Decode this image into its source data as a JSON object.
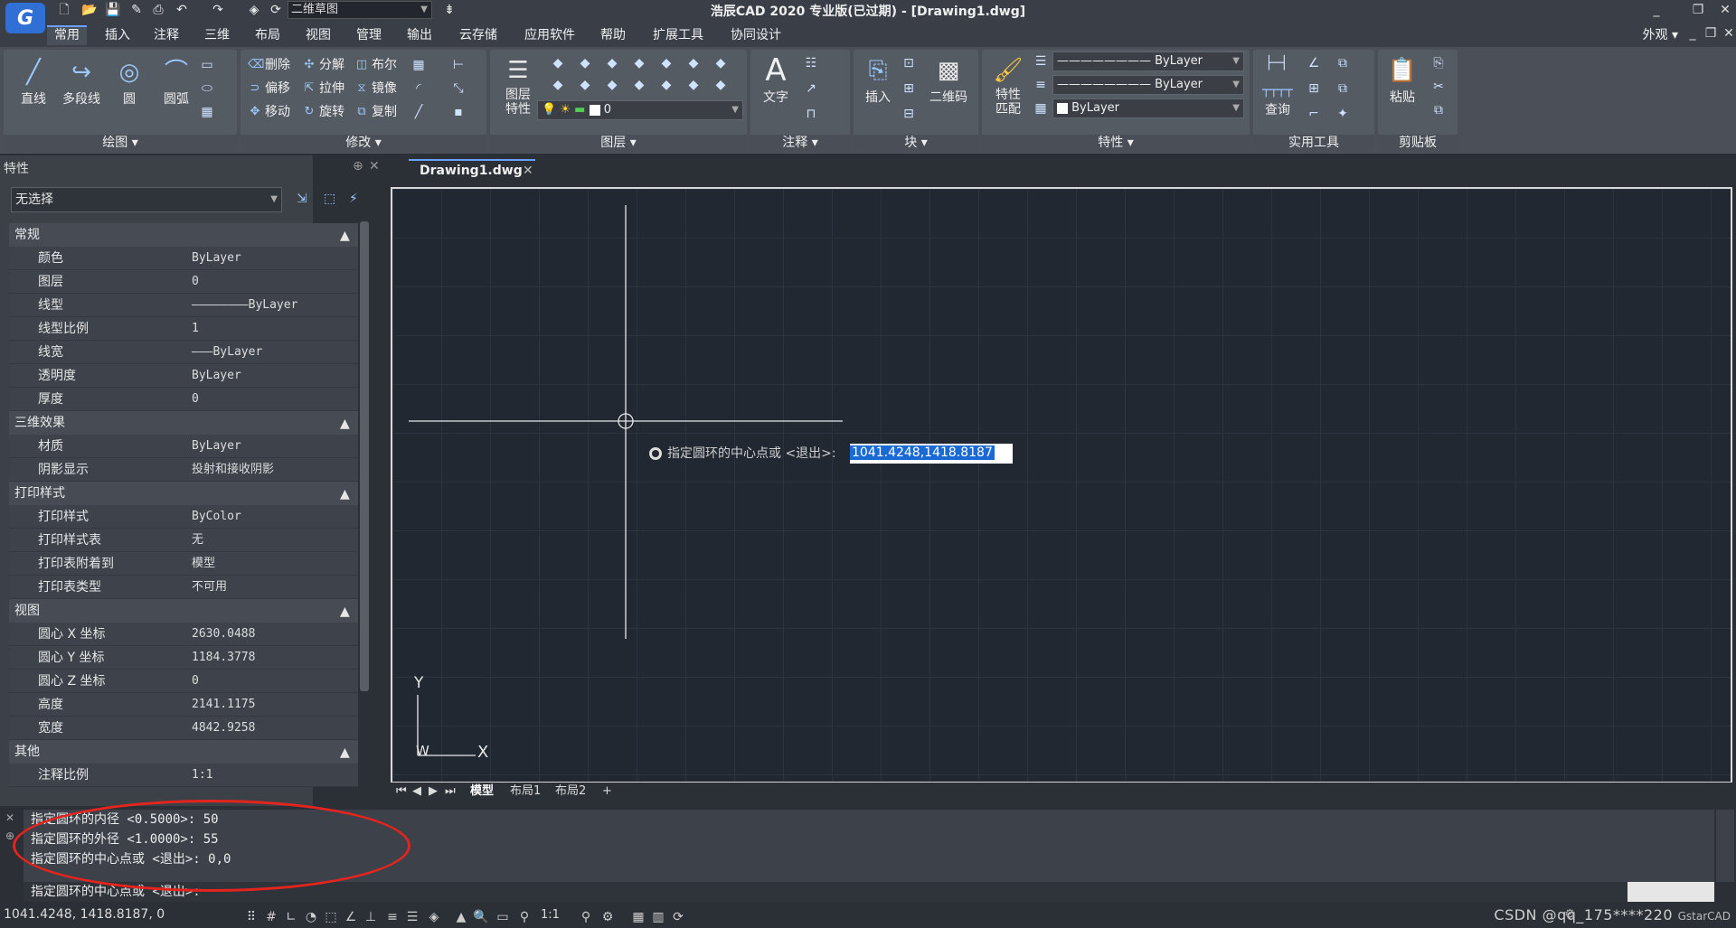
{
  "titlebar": {
    "title": "浩辰CAD 2020 专业版(已过期) - [Drawing1.dwg]",
    "workspace": "二维草图",
    "logo_text": "G"
  },
  "menu": {
    "tabs": [
      "常用",
      "插入",
      "注释",
      "三维",
      "布局",
      "视图",
      "管理",
      "输出",
      "云存储",
      "应用软件",
      "帮助",
      "扩展工具",
      "协同设计"
    ],
    "active_index": 0,
    "appearance": "外观"
  },
  "ribbon": {
    "draw": {
      "title": "绘图",
      "line": "直线",
      "polyline": "多段线",
      "circle": "圆",
      "arc": "圆弧"
    },
    "modify": {
      "title": "修改",
      "erase": "删除",
      "explode": "分解",
      "boolean": "布尔",
      "offset": "偏移",
      "stretch": "拉伸",
      "mirror": "镜像",
      "move": "移动",
      "rotate": "旋转",
      "copy": "复制"
    },
    "layers": {
      "title": "图层",
      "layer_props": "图层\n特性",
      "current_layer": "0"
    },
    "annotation": {
      "title": "注释",
      "text": "文字"
    },
    "block": {
      "title": "块",
      "insert": "插入",
      "qrcode": "二维码"
    },
    "properties": {
      "title": "特性",
      "match": "特性\n匹配",
      "linetype1": "ByLayer",
      "linetype2": "ByLayer",
      "color": "ByLayer"
    },
    "utilities": {
      "title": "实用工具",
      "query": "查询"
    },
    "clipboard": {
      "title": "剪贴板",
      "paste": "粘贴"
    }
  },
  "properties_palette": {
    "header": "特性",
    "selection": "无选择",
    "sections": [
      {
        "title": "常规",
        "rows": [
          [
            "颜色",
            "ByLayer"
          ],
          [
            "图层",
            "0"
          ],
          [
            "线型",
            "————————ByLayer"
          ],
          [
            "线型比例",
            "1"
          ],
          [
            "线宽",
            "———ByLayer"
          ],
          [
            "透明度",
            "ByLayer"
          ],
          [
            "厚度",
            "0"
          ]
        ]
      },
      {
        "title": "三维效果",
        "rows": [
          [
            "材质",
            "ByLayer"
          ],
          [
            "阴影显示",
            "投射和接收阴影"
          ]
        ]
      },
      {
        "title": "打印样式",
        "rows": [
          [
            "打印样式",
            "ByColor"
          ],
          [
            "打印样式表",
            "无"
          ],
          [
            "打印表附着到",
            "模型"
          ],
          [
            "打印表类型",
            "不可用"
          ]
        ]
      },
      {
        "title": "视图",
        "rows": [
          [
            "圆心 X 坐标",
            "2630.0488"
          ],
          [
            "圆心 Y 坐标",
            "1184.3778"
          ],
          [
            "圆心 Z 坐标",
            "0"
          ],
          [
            "高度",
            "2141.1175"
          ],
          [
            "宽度",
            "4842.9258"
          ]
        ]
      },
      {
        "title": "其他",
        "rows": [
          [
            "注释比例",
            "1:1"
          ]
        ]
      }
    ]
  },
  "document": {
    "tab": "Drawing1.dwg",
    "prompt": "指定圆环的中心点或 <退出>:",
    "coord_input": "1041.4248,1418.8187",
    "ucs_x": "X",
    "ucs_y": "Y",
    "ucs_w": "W",
    "layout_tabs": [
      "模型",
      "布局1",
      "布局2",
      "+"
    ]
  },
  "command": {
    "history": [
      "指定圆环的内径 <0.5000>: 50",
      "指定圆环的外径 <1.0000>: 55",
      "指定圆环的中心点或 <退出>: 0,0"
    ],
    "prompt": "指定圆环的中心点或 <退出>:"
  },
  "status": {
    "coords": "1041.4248, 1418.8187, 0",
    "scale": "1:1",
    "watermark": "CSDN @qq_175****220",
    "app_brand": "GstarCAD"
  }
}
